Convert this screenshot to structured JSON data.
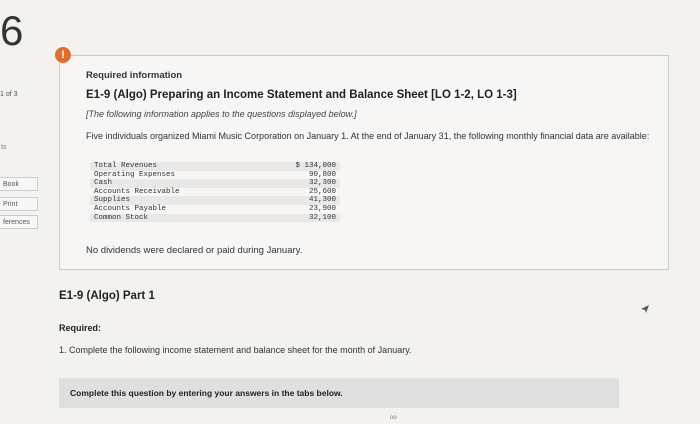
{
  "left_rail": {
    "question_number": "6",
    "counter": "1 of 3",
    "ts_label": "ts",
    "links": [
      {
        "label": "Book"
      },
      {
        "label": "Print"
      },
      {
        "label": "ferences"
      }
    ]
  },
  "info": {
    "required_information": "Required information",
    "exercise_title": "E1-9 (Algo) Preparing an Income Statement and Balance Sheet [LO 1-2, LO 1-3]",
    "note": "[The following information applies to the questions displayed below.]",
    "intro": "Five individuals organized Miami Music Corporation on January 1. At the end of January 31, the following monthly financial data are available:",
    "table": [
      {
        "label": "Total Revenues",
        "value": "$ 134,000"
      },
      {
        "label": "Operating Expenses",
        "value": "90,800"
      },
      {
        "label": "Cash",
        "value": "32,300"
      },
      {
        "label": "Accounts Receivable",
        "value": "25,600"
      },
      {
        "label": "Supplies",
        "value": "41,300"
      },
      {
        "label": "Accounts Payable",
        "value": "23,900"
      },
      {
        "label": "Common Stock",
        "value": "32,100"
      }
    ],
    "dividends_note": "No dividends were declared or paid during January."
  },
  "part": {
    "title": "E1-9 (Algo) Part 1",
    "required_label": "Required:",
    "task": "1. Complete the following income statement and balance sheet for the month of January.",
    "complete_prompt": "Complete this question by entering your answers in the tabs below."
  },
  "icons": {
    "alert": "alert-icon",
    "cursor": "cursor-icon"
  },
  "colors": {
    "alert": "#e06d2f",
    "panel": "#dfdfdf"
  }
}
